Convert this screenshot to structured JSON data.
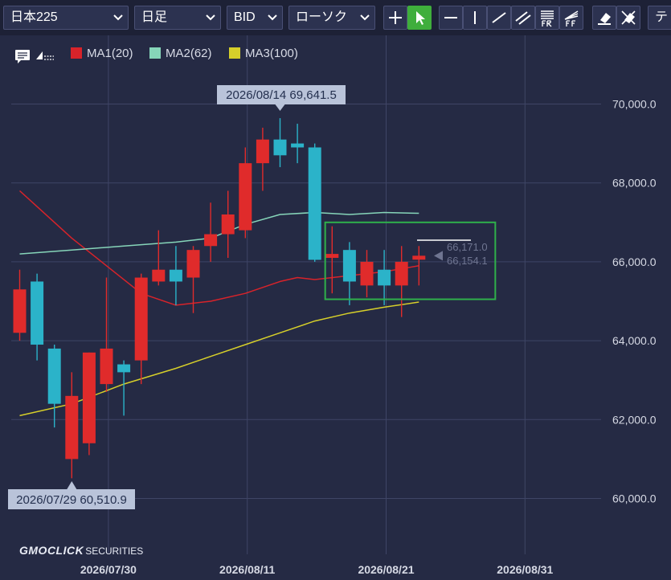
{
  "toolbar": {
    "symbol": "日本225",
    "period": "日足",
    "price_type": "BID",
    "chart_type": "ローソク",
    "overflow_label": "テ"
  },
  "legend": {
    "series": [
      {
        "label": "MA1(20)",
        "color": "#d8232a"
      },
      {
        "label": "MA2(62)",
        "color": "#86d5b9"
      },
      {
        "label": "MA3(100)",
        "color": "#d6cf2a"
      }
    ]
  },
  "colors": {
    "background": "#252a44",
    "grid": "#3f4566",
    "up": "#e02b2b",
    "down": "#2bb3c9",
    "selection": "#2fb04b",
    "annotation_bg": "#b9c3d9"
  },
  "annotations": {
    "high": "2026/08/14 69,641.5",
    "low": "2026/07/29 60,510.9",
    "price_upper": "66,171.0",
    "price_lower": "66,154.1"
  },
  "logo": {
    "main": "GMOCLICK",
    "sub": "SECURITIES"
  },
  "chart_data": {
    "type": "candlestick",
    "y_ticks": [
      60000,
      62000,
      64000,
      66000,
      68000,
      70000
    ],
    "y_tick_labels": [
      "60,000.0",
      "62,000.0",
      "64,000.0",
      "66,000.0",
      "68,000.0",
      "70,000.0"
    ],
    "ylim": [
      59000,
      71800
    ],
    "x_tick_labels": [
      "2026/07/30",
      "2026/08/11",
      "2026/08/21",
      "2026/08/31"
    ],
    "grid": true,
    "candles": [
      {
        "date": "2026/07/22",
        "open": 64200,
        "high": 65800,
        "low": 64000,
        "close": 65300
      },
      {
        "date": "2026/07/23",
        "open": 65500,
        "high": 65700,
        "low": 63500,
        "close": 63900
      },
      {
        "date": "2026/07/24",
        "open": 63800,
        "high": 63900,
        "low": 61800,
        "close": 62400
      },
      {
        "date": "2026/07/29",
        "open": 61000,
        "high": 63200,
        "low": 60511,
        "close": 62600
      },
      {
        "date": "2026/07/30",
        "open": 61400,
        "high": 63700,
        "low": 61100,
        "close": 63700
      },
      {
        "date": "2026/07/31",
        "open": 62900,
        "high": 65600,
        "low": 62700,
        "close": 63800
      },
      {
        "date": "2026/08/01",
        "open": 63400,
        "high": 63500,
        "low": 62100,
        "close": 63200
      },
      {
        "date": "2026/08/04",
        "open": 63500,
        "high": 65700,
        "low": 62900,
        "close": 65600
      },
      {
        "date": "2026/08/05",
        "open": 65500,
        "high": 66800,
        "low": 65400,
        "close": 65800
      },
      {
        "date": "2026/08/06",
        "open": 65800,
        "high": 66400,
        "low": 64900,
        "close": 65500
      },
      {
        "date": "2026/08/07",
        "open": 65600,
        "high": 66400,
        "low": 64700,
        "close": 66300
      },
      {
        "date": "2026/08/08",
        "open": 66400,
        "high": 67500,
        "low": 66000,
        "close": 66700
      },
      {
        "date": "2026/08/11",
        "open": 66700,
        "high": 67800,
        "low": 66100,
        "close": 67200
      },
      {
        "date": "2026/08/12",
        "open": 66800,
        "high": 68900,
        "low": 66600,
        "close": 68500
      },
      {
        "date": "2026/08/13",
        "open": 68500,
        "high": 69400,
        "low": 67800,
        "close": 69100
      },
      {
        "date": "2026/08/14",
        "open": 69100,
        "high": 69642,
        "low": 68400,
        "close": 68700
      },
      {
        "date": "2026/08/15",
        "open": 69000,
        "high": 69500,
        "low": 68500,
        "close": 68900
      },
      {
        "date": "2026/08/18",
        "open": 68900,
        "high": 69000,
        "low": 66000,
        "close": 66050
      },
      {
        "date": "2026/08/19",
        "open": 66100,
        "high": 66900,
        "low": 65200,
        "close": 66200
      },
      {
        "date": "2026/08/20",
        "open": 66300,
        "high": 66500,
        "low": 64900,
        "close": 65500
      },
      {
        "date": "2026/08/21",
        "open": 65400,
        "high": 66300,
        "low": 65100,
        "close": 66000
      },
      {
        "date": "2026/08/22",
        "open": 65800,
        "high": 66300,
        "low": 64900,
        "close": 65400
      },
      {
        "date": "2026/08/25",
        "open": 65400,
        "high": 66400,
        "low": 64600,
        "close": 66000
      },
      {
        "date": "2026/08/26",
        "open": 66054,
        "high": 66400,
        "low": 65400,
        "close": 66154
      }
    ],
    "series": [
      {
        "name": "MA1(20)",
        "color": "#d8232a",
        "values": [
          [
            0,
            67800
          ],
          [
            3,
            66600
          ],
          [
            5,
            65900
          ],
          [
            7,
            65200
          ],
          [
            9,
            64900
          ],
          [
            11,
            65000
          ],
          [
            13,
            65200
          ],
          [
            15,
            65500
          ],
          [
            16,
            65600
          ],
          [
            17,
            65550
          ],
          [
            19,
            65650
          ],
          [
            21,
            65750
          ],
          [
            23,
            65900
          ]
        ]
      },
      {
        "name": "MA2(62)",
        "color": "#86d5b9",
        "values": [
          [
            0,
            66200
          ],
          [
            3,
            66300
          ],
          [
            6,
            66400
          ],
          [
            9,
            66500
          ],
          [
            11,
            66600
          ],
          [
            13,
            66950
          ],
          [
            15,
            67200
          ],
          [
            17,
            67250
          ],
          [
            19,
            67200
          ],
          [
            21,
            67250
          ],
          [
            23,
            67230
          ]
        ]
      },
      {
        "name": "MA3(100)",
        "color": "#d6cf2a",
        "values": [
          [
            0,
            62100
          ],
          [
            3,
            62400
          ],
          [
            6,
            62900
          ],
          [
            9,
            63300
          ],
          [
            11,
            63600
          ],
          [
            13,
            63900
          ],
          [
            15,
            64200
          ],
          [
            17,
            64500
          ],
          [
            19,
            64700
          ],
          [
            21,
            64850
          ],
          [
            23,
            64980
          ]
        ]
      }
    ],
    "selection": {
      "x_from": 17.6,
      "x_to": 27.4,
      "y_from": 65050,
      "y_to": 67000
    }
  }
}
